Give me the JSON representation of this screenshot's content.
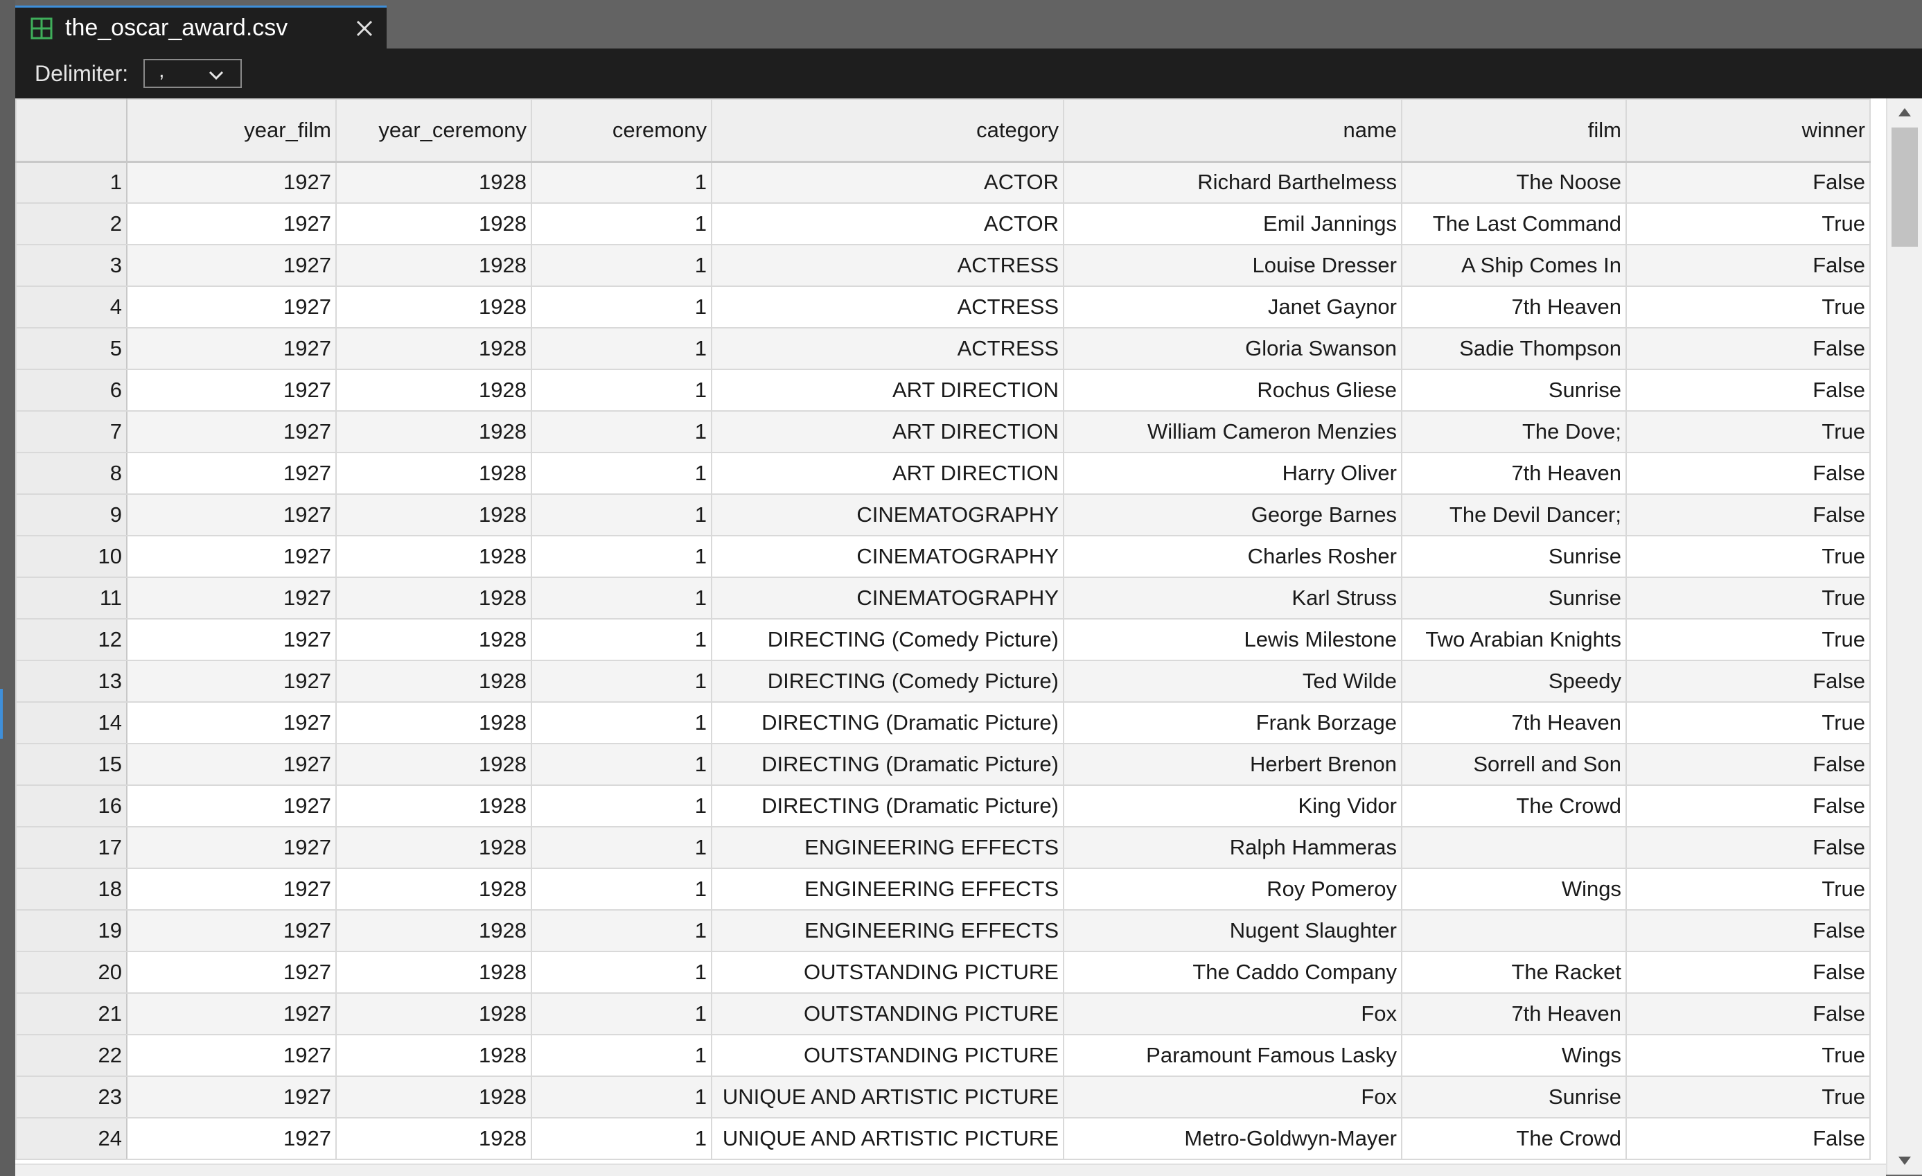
{
  "tab": {
    "title": "the_oscar_award.csv",
    "icon": "table-grid-icon",
    "close_icon": "close-icon"
  },
  "toolbar": {
    "delimiter_label": "Delimiter:",
    "delimiter_value": ","
  },
  "grid": {
    "columns": [
      "",
      "year_film",
      "year_ceremony",
      "ceremony",
      "category",
      "name",
      "film",
      "winner"
    ],
    "rows": [
      [
        "1",
        "1927",
        "1928",
        "1",
        "ACTOR",
        "Richard Barthelmess",
        "The Noose",
        "False"
      ],
      [
        "2",
        "1927",
        "1928",
        "1",
        "ACTOR",
        "Emil Jannings",
        "The Last Command",
        "True"
      ],
      [
        "3",
        "1927",
        "1928",
        "1",
        "ACTRESS",
        "Louise Dresser",
        "A Ship Comes In",
        "False"
      ],
      [
        "4",
        "1927",
        "1928",
        "1",
        "ACTRESS",
        "Janet Gaynor",
        "7th Heaven",
        "True"
      ],
      [
        "5",
        "1927",
        "1928",
        "1",
        "ACTRESS",
        "Gloria Swanson",
        "Sadie Thompson",
        "False"
      ],
      [
        "6",
        "1927",
        "1928",
        "1",
        "ART DIRECTION",
        "Rochus Gliese",
        "Sunrise",
        "False"
      ],
      [
        "7",
        "1927",
        "1928",
        "1",
        "ART DIRECTION",
        "William Cameron Menzies",
        "The Dove;",
        "True"
      ],
      [
        "8",
        "1927",
        "1928",
        "1",
        "ART DIRECTION",
        "Harry Oliver",
        "7th Heaven",
        "False"
      ],
      [
        "9",
        "1927",
        "1928",
        "1",
        "CINEMATOGRAPHY",
        "George Barnes",
        "The Devil Dancer;",
        "False"
      ],
      [
        "10",
        "1927",
        "1928",
        "1",
        "CINEMATOGRAPHY",
        "Charles Rosher",
        "Sunrise",
        "True"
      ],
      [
        "11",
        "1927",
        "1928",
        "1",
        "CINEMATOGRAPHY",
        "Karl Struss",
        "Sunrise",
        "True"
      ],
      [
        "12",
        "1927",
        "1928",
        "1",
        "DIRECTING (Comedy Picture)",
        "Lewis Milestone",
        "Two Arabian Knights",
        "True"
      ],
      [
        "13",
        "1927",
        "1928",
        "1",
        "DIRECTING (Comedy Picture)",
        "Ted Wilde",
        "Speedy",
        "False"
      ],
      [
        "14",
        "1927",
        "1928",
        "1",
        "DIRECTING (Dramatic Picture)",
        "Frank Borzage",
        "7th Heaven",
        "True"
      ],
      [
        "15",
        "1927",
        "1928",
        "1",
        "DIRECTING (Dramatic Picture)",
        "Herbert Brenon",
        "Sorrell and Son",
        "False"
      ],
      [
        "16",
        "1927",
        "1928",
        "1",
        "DIRECTING (Dramatic Picture)",
        "King Vidor",
        "The Crowd",
        "False"
      ],
      [
        "17",
        "1927",
        "1928",
        "1",
        "ENGINEERING EFFECTS",
        "Ralph Hammeras",
        "",
        "False"
      ],
      [
        "18",
        "1927",
        "1928",
        "1",
        "ENGINEERING EFFECTS",
        "Roy Pomeroy",
        "Wings",
        "True"
      ],
      [
        "19",
        "1927",
        "1928",
        "1",
        "ENGINEERING EFFECTS",
        "Nugent Slaughter",
        "",
        "False"
      ],
      [
        "20",
        "1927",
        "1928",
        "1",
        "OUTSTANDING PICTURE",
        "The Caddo Company",
        "The Racket",
        "False"
      ],
      [
        "21",
        "1927",
        "1928",
        "1",
        "OUTSTANDING PICTURE",
        "Fox",
        "7th Heaven",
        "False"
      ],
      [
        "22",
        "1927",
        "1928",
        "1",
        "OUTSTANDING PICTURE",
        "Paramount Famous Lasky",
        "Wings",
        "True"
      ],
      [
        "23",
        "1927",
        "1928",
        "1",
        "UNIQUE AND ARTISTIC PICTURE",
        "Fox",
        "Sunrise",
        "True"
      ],
      [
        "24",
        "1927",
        "1928",
        "1",
        "UNIQUE AND ARTISTIC PICTURE",
        "Metro-Goldwyn-Mayer",
        "The Crowd",
        "False"
      ]
    ]
  },
  "colors": {
    "accent": "#3f8fd9",
    "tab_icon": "#3fae5a",
    "editor_bg": "#1e1e1e",
    "grid_header_bg": "#efefef"
  }
}
